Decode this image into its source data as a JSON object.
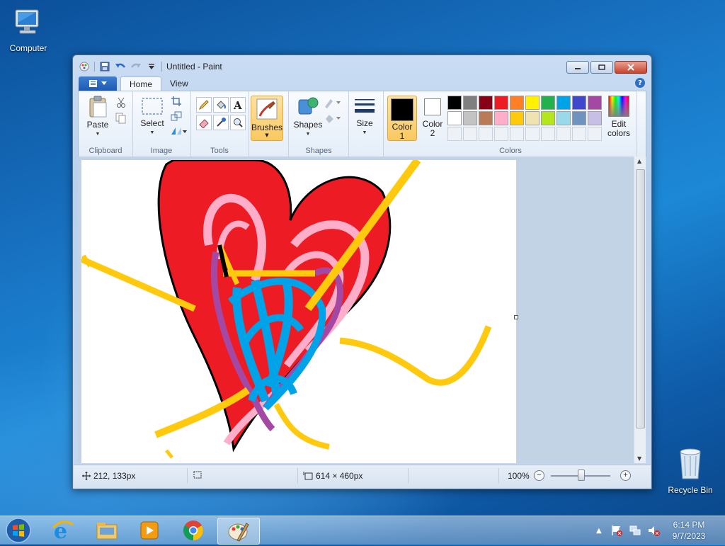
{
  "desktop": {
    "icons": [
      {
        "label": "Computer",
        "icon": "computer-icon"
      },
      {
        "label": "Recycle Bin",
        "icon": "recycle-bin-icon"
      }
    ]
  },
  "window": {
    "title": "Untitled - Paint",
    "quick_access": [
      "paint-menu-icon",
      "save-icon",
      "undo-icon",
      "redo-icon",
      "customize-dropdown-icon"
    ]
  },
  "tabs": {
    "home": "Home",
    "view": "View"
  },
  "ribbon": {
    "groups": {
      "clipboard": "Clipboard",
      "image": "Image",
      "tools": "Tools",
      "shapes": "Shapes",
      "colors": "Colors"
    },
    "paste": "Paste",
    "select": "Select",
    "brushes": "Brushes",
    "shapes_btn": "Shapes",
    "size": "Size",
    "color1_line1": "Color",
    "color1_line2": "1",
    "color2_line1": "Color",
    "color2_line2": "2",
    "edit_colors_line1": "Edit",
    "edit_colors_line2": "colors",
    "color1_value": "#000000",
    "color2_value": "#ffffff",
    "palette": [
      "#000000",
      "#7f7f7f",
      "#880015",
      "#ed1c24",
      "#ff7f27",
      "#fff200",
      "#22b14c",
      "#00a2e8",
      "#3f48cc",
      "#a349a4",
      "#ffffff",
      "#c3c3c3",
      "#b97a57",
      "#ffaec9",
      "#ffc90e",
      "#efe4b0",
      "#b5e61d",
      "#99d9ea",
      "#7092be",
      "#c8bfe7"
    ]
  },
  "status": {
    "cursor_pos": "212, 133px",
    "canvas_size": "614 × 460px",
    "zoom": "100%",
    "zoom_level_fraction": 0.5
  },
  "taskbar": {
    "items": [
      "start-orb",
      "internet-explorer-icon",
      "file-explorer-icon",
      "media-player-icon",
      "chrome-icon",
      "paint-icon"
    ],
    "time": "6:14 PM",
    "date": "9/7/2023"
  }
}
